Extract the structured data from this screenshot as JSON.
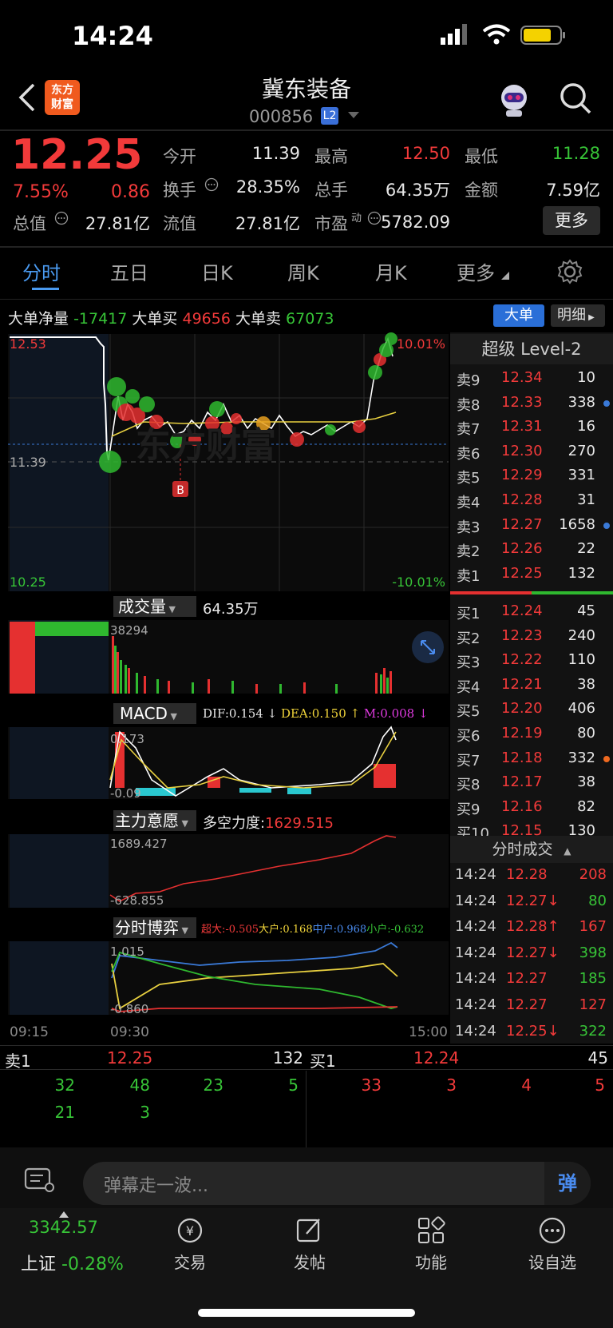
{
  "status_bar": {
    "time": "14:24"
  },
  "header": {
    "logo_text_1": "东方",
    "logo_text_2": "财富",
    "stock_name": "冀东装备",
    "stock_code": "000856",
    "level_badge": "L2"
  },
  "quote": {
    "price": "12.25",
    "change_pct": "7.55%",
    "change": "0.86",
    "open_label": "今开",
    "open": "11.39",
    "high_label": "最高",
    "high": "12.50",
    "low_label": "最低",
    "low": "11.28",
    "turnover_label": "换手",
    "turnover": "28.35%",
    "volume_label": "总手",
    "volume": "64.35万",
    "amount_label": "金额",
    "amount": "7.59亿",
    "mktcap_label": "总值",
    "mktcap": "27.81亿",
    "float_label": "流值",
    "float": "27.81亿",
    "pe_label": "市盈",
    "pe_sup": "动",
    "pe": "5782.09",
    "more_button": "更多"
  },
  "tabs": [
    "分时",
    "五日",
    "日K",
    "周K",
    "月K",
    "更多"
  ],
  "bigorder": {
    "net_label": "大单净量",
    "net": "-17417",
    "buy_label": "大单买",
    "buy": "49656",
    "sell_label": "大单卖",
    "sell": "67073",
    "btn_big": "大单",
    "btn_detail": "明细"
  },
  "intraday": {
    "price_top": "12.53",
    "price_bottom": "10.25",
    "pct_top": "10.01%",
    "pct_bottom": "-10.01%",
    "ref_price": "11.39",
    "marker": "B",
    "watermark": "东方财富"
  },
  "volume_panel": {
    "label": "成交量",
    "value": "64.35万",
    "max": "38294"
  },
  "macd_panel": {
    "label": "MACD",
    "dif": "DIF:0.154",
    "dea": "DEA:0.150",
    "m": "M:0.008",
    "top": "0.173",
    "bottom": "-0.09"
  },
  "main_panel": {
    "label": "主力意愿",
    "force_label": "多空力度:",
    "force": "1629.515",
    "top": "1689.427",
    "bottom": "-628.855"
  },
  "game_panel": {
    "label": "分时博弈",
    "super": "超大:-0.505",
    "large": "大户:0.168",
    "mid": "中户:0.968",
    "small": "小户:-0.632",
    "top": "1.015",
    "bottom": "-0.860"
  },
  "time_axis": {
    "t1": "09:15",
    "t2": "09:30",
    "t3": "15:00"
  },
  "level2_title": "超级 Level-2",
  "asks": [
    {
      "label": "卖9",
      "price": "12.34",
      "vol": "10",
      "dot": ""
    },
    {
      "label": "卖8",
      "price": "12.33",
      "vol": "338",
      "dot": "blue"
    },
    {
      "label": "卖7",
      "price": "12.31",
      "vol": "16",
      "dot": ""
    },
    {
      "label": "卖6",
      "price": "12.30",
      "vol": "270",
      "dot": ""
    },
    {
      "label": "卖5",
      "price": "12.29",
      "vol": "331",
      "dot": ""
    },
    {
      "label": "卖4",
      "price": "12.28",
      "vol": "31",
      "dot": ""
    },
    {
      "label": "卖3",
      "price": "12.27",
      "vol": "1658",
      "dot": "blue"
    },
    {
      "label": "卖2",
      "price": "12.26",
      "vol": "22",
      "dot": ""
    },
    {
      "label": "卖1",
      "price": "12.25",
      "vol": "132",
      "dot": ""
    }
  ],
  "bids": [
    {
      "label": "买1",
      "price": "12.24",
      "vol": "45",
      "dot": ""
    },
    {
      "label": "买2",
      "price": "12.23",
      "vol": "240",
      "dot": ""
    },
    {
      "label": "买3",
      "price": "12.22",
      "vol": "110",
      "dot": ""
    },
    {
      "label": "买4",
      "price": "12.21",
      "vol": "38",
      "dot": ""
    },
    {
      "label": "买5",
      "price": "12.20",
      "vol": "406",
      "dot": ""
    },
    {
      "label": "买6",
      "price": "12.19",
      "vol": "80",
      "dot": ""
    },
    {
      "label": "买7",
      "price": "12.18",
      "vol": "332",
      "dot": "orange"
    },
    {
      "label": "买8",
      "price": "12.17",
      "vol": "38",
      "dot": ""
    },
    {
      "label": "买9",
      "price": "12.16",
      "vol": "82",
      "dot": ""
    },
    {
      "label": "买10",
      "price": "12.15",
      "vol": "130",
      "dot": ""
    }
  ],
  "ticks_title": "分时成交",
  "ticks": [
    {
      "time": "14:24",
      "price": "12.28",
      "vol": "208",
      "pc": "red",
      "vc": "red"
    },
    {
      "time": "14:24",
      "price": "12.27↓",
      "vol": "80",
      "pc": "red",
      "vc": "green"
    },
    {
      "time": "14:24",
      "price": "12.28↑",
      "vol": "167",
      "pc": "red",
      "vc": "red"
    },
    {
      "time": "14:24",
      "price": "12.27↓",
      "vol": "398",
      "pc": "red",
      "vc": "green"
    },
    {
      "time": "14:24",
      "price": "12.27",
      "vol": "185",
      "pc": "red",
      "vc": "green"
    },
    {
      "time": "14:24",
      "price": "12.27",
      "vol": "127",
      "pc": "red",
      "vc": "red"
    },
    {
      "time": "14:24",
      "price": "12.25↓",
      "vol": "322",
      "pc": "red",
      "vc": "green"
    }
  ],
  "queue": {
    "sell_label": "卖1",
    "sell_price": "12.25",
    "sell_vol": "132",
    "buy_label": "买1",
    "buy_price": "12.24",
    "buy_vol": "45",
    "sell_row1": [
      "32",
      "48",
      "23",
      "5"
    ],
    "sell_row2": [
      "21",
      "3"
    ],
    "buy_row1": [
      "33",
      "3",
      "4",
      "5"
    ]
  },
  "danmaku": {
    "placeholder": "弹幕走一波...",
    "send": "弹"
  },
  "bottom_nav": {
    "index_value": "3342.57",
    "index_name": "上证",
    "index_change": "-0.28%",
    "items": [
      "交易",
      "发帖",
      "功能",
      "设自选"
    ]
  }
}
